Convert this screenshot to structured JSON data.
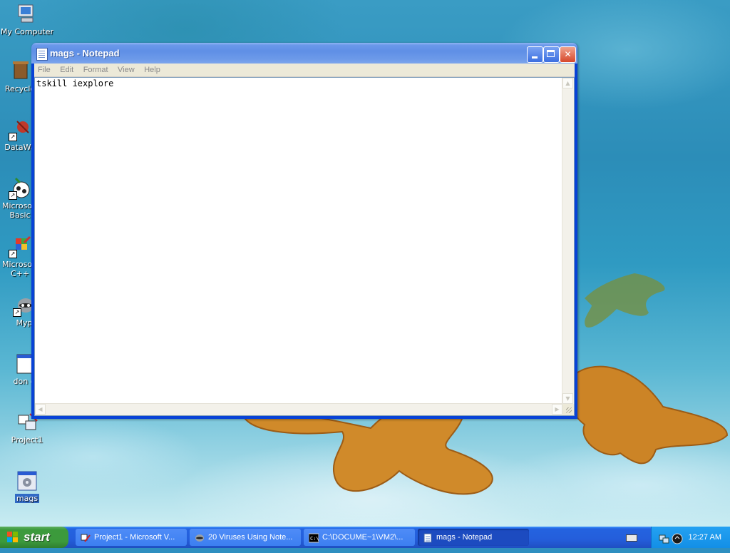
{
  "desktop": {
    "icons": [
      {
        "label": "My Computer",
        "name": "my-computer"
      },
      {
        "label": "Recycle",
        "name": "recycle-bin"
      },
      {
        "label": "DataWa",
        "name": "datawa-shortcut"
      },
      {
        "label": "Microsoft Basic",
        "label_line1": "Microsoft",
        "label_line2": "Basic",
        "name": "microsoft-basic-shortcut"
      },
      {
        "label": "Microsoft C++",
        "label_line1": "Microsoft",
        "label_line2": "C++",
        "name": "microsoft-cpp-shortcut"
      },
      {
        "label": "Myp",
        "name": "myp-shortcut"
      },
      {
        "label": "don o",
        "name": "don-o-file"
      },
      {
        "label": "Project1",
        "name": "project1-file"
      },
      {
        "label": "mags",
        "name": "mags-file"
      }
    ]
  },
  "window": {
    "title": "mags - Notepad",
    "menu": [
      "File",
      "Edit",
      "Format",
      "View",
      "Help"
    ],
    "content": "tskill iexplore"
  },
  "taskbar": {
    "start_label": "start",
    "tasks": [
      {
        "label": "Project1 - Microsoft V...",
        "icon": "vb-icon",
        "active": false
      },
      {
        "label": "20 Viruses Using Note...",
        "icon": "browser-icon",
        "active": false
      },
      {
        "label": "C:\\DOCUME~1\\VM2\\...",
        "icon": "cmd-icon",
        "active": false
      },
      {
        "label": "mags - Notepad",
        "icon": "notepad-icon",
        "active": true
      }
    ],
    "clock": "12:27 AM"
  },
  "colors": {
    "titlebar": "#0842d6",
    "taskbar": "#245edb",
    "start_button": "#3c9a3c",
    "tray": "#138fe6",
    "selection": "#316ac5"
  }
}
